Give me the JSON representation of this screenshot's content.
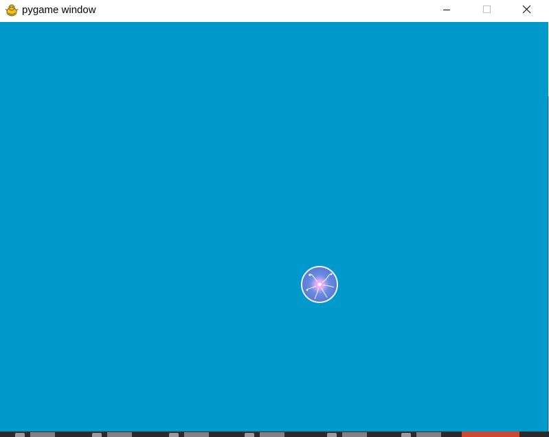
{
  "window": {
    "title": "pygame window",
    "icon": "pygame-snake-icon",
    "controls": [
      "minimize-icon",
      "maximize-icon",
      "close-icon"
    ]
  },
  "game": {
    "background_color": "#0099cc",
    "sprite": "plasma-ball"
  },
  "taskbar": {
    "item_count": 6,
    "accent_color": "#c94a2e"
  }
}
